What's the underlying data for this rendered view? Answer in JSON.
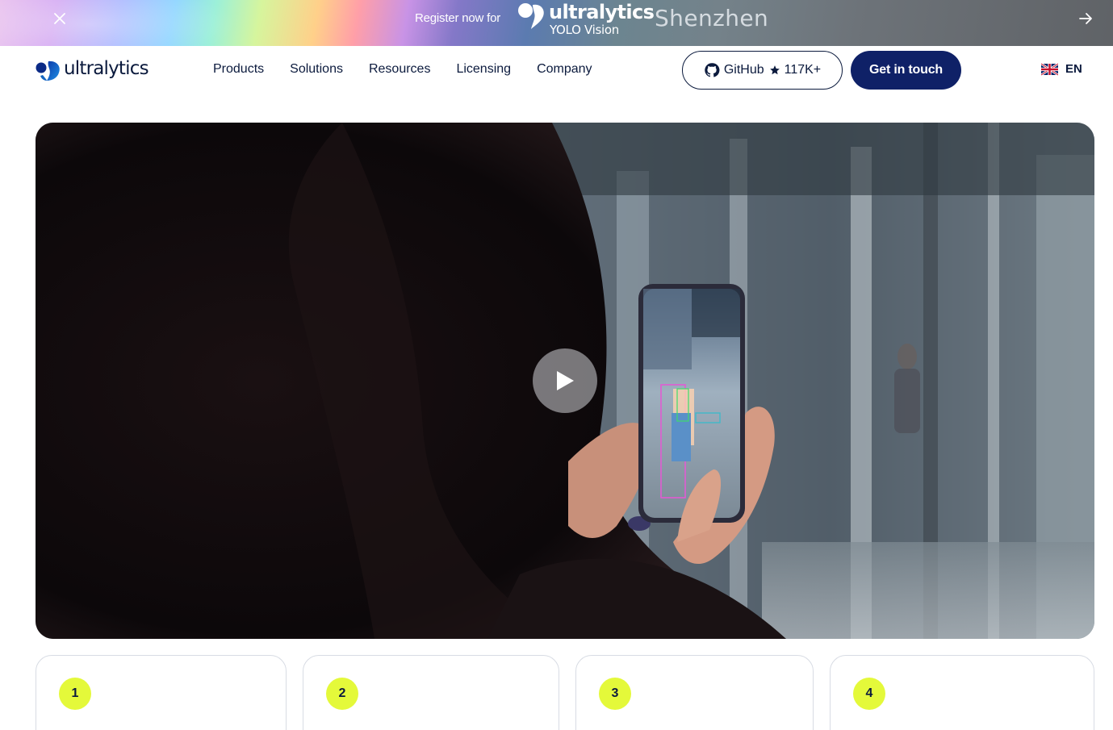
{
  "banner": {
    "register_text": "Register now for",
    "brand": "ultralytics",
    "event": "YOLO Vision",
    "city": "Shenzhen",
    "close_icon": "close-icon",
    "arrow_icon": "arrow-right-icon"
  },
  "nav": {
    "logo_text": "ultralytics",
    "menu": [
      "Products",
      "Solutions",
      "Resources",
      "Licensing",
      "Company"
    ],
    "github": {
      "label": "GitHub",
      "stars": "117K+"
    },
    "cta_label": "Get in touch",
    "language": "EN"
  },
  "hero": {
    "play_icon": "play-icon"
  },
  "steps": [
    "1",
    "2",
    "3",
    "4"
  ],
  "colors": {
    "navy": "#0f2167",
    "text": "#0b1a3d",
    "accent_lime": "#e4f93a",
    "brand_blue": "#1b7bd8"
  }
}
